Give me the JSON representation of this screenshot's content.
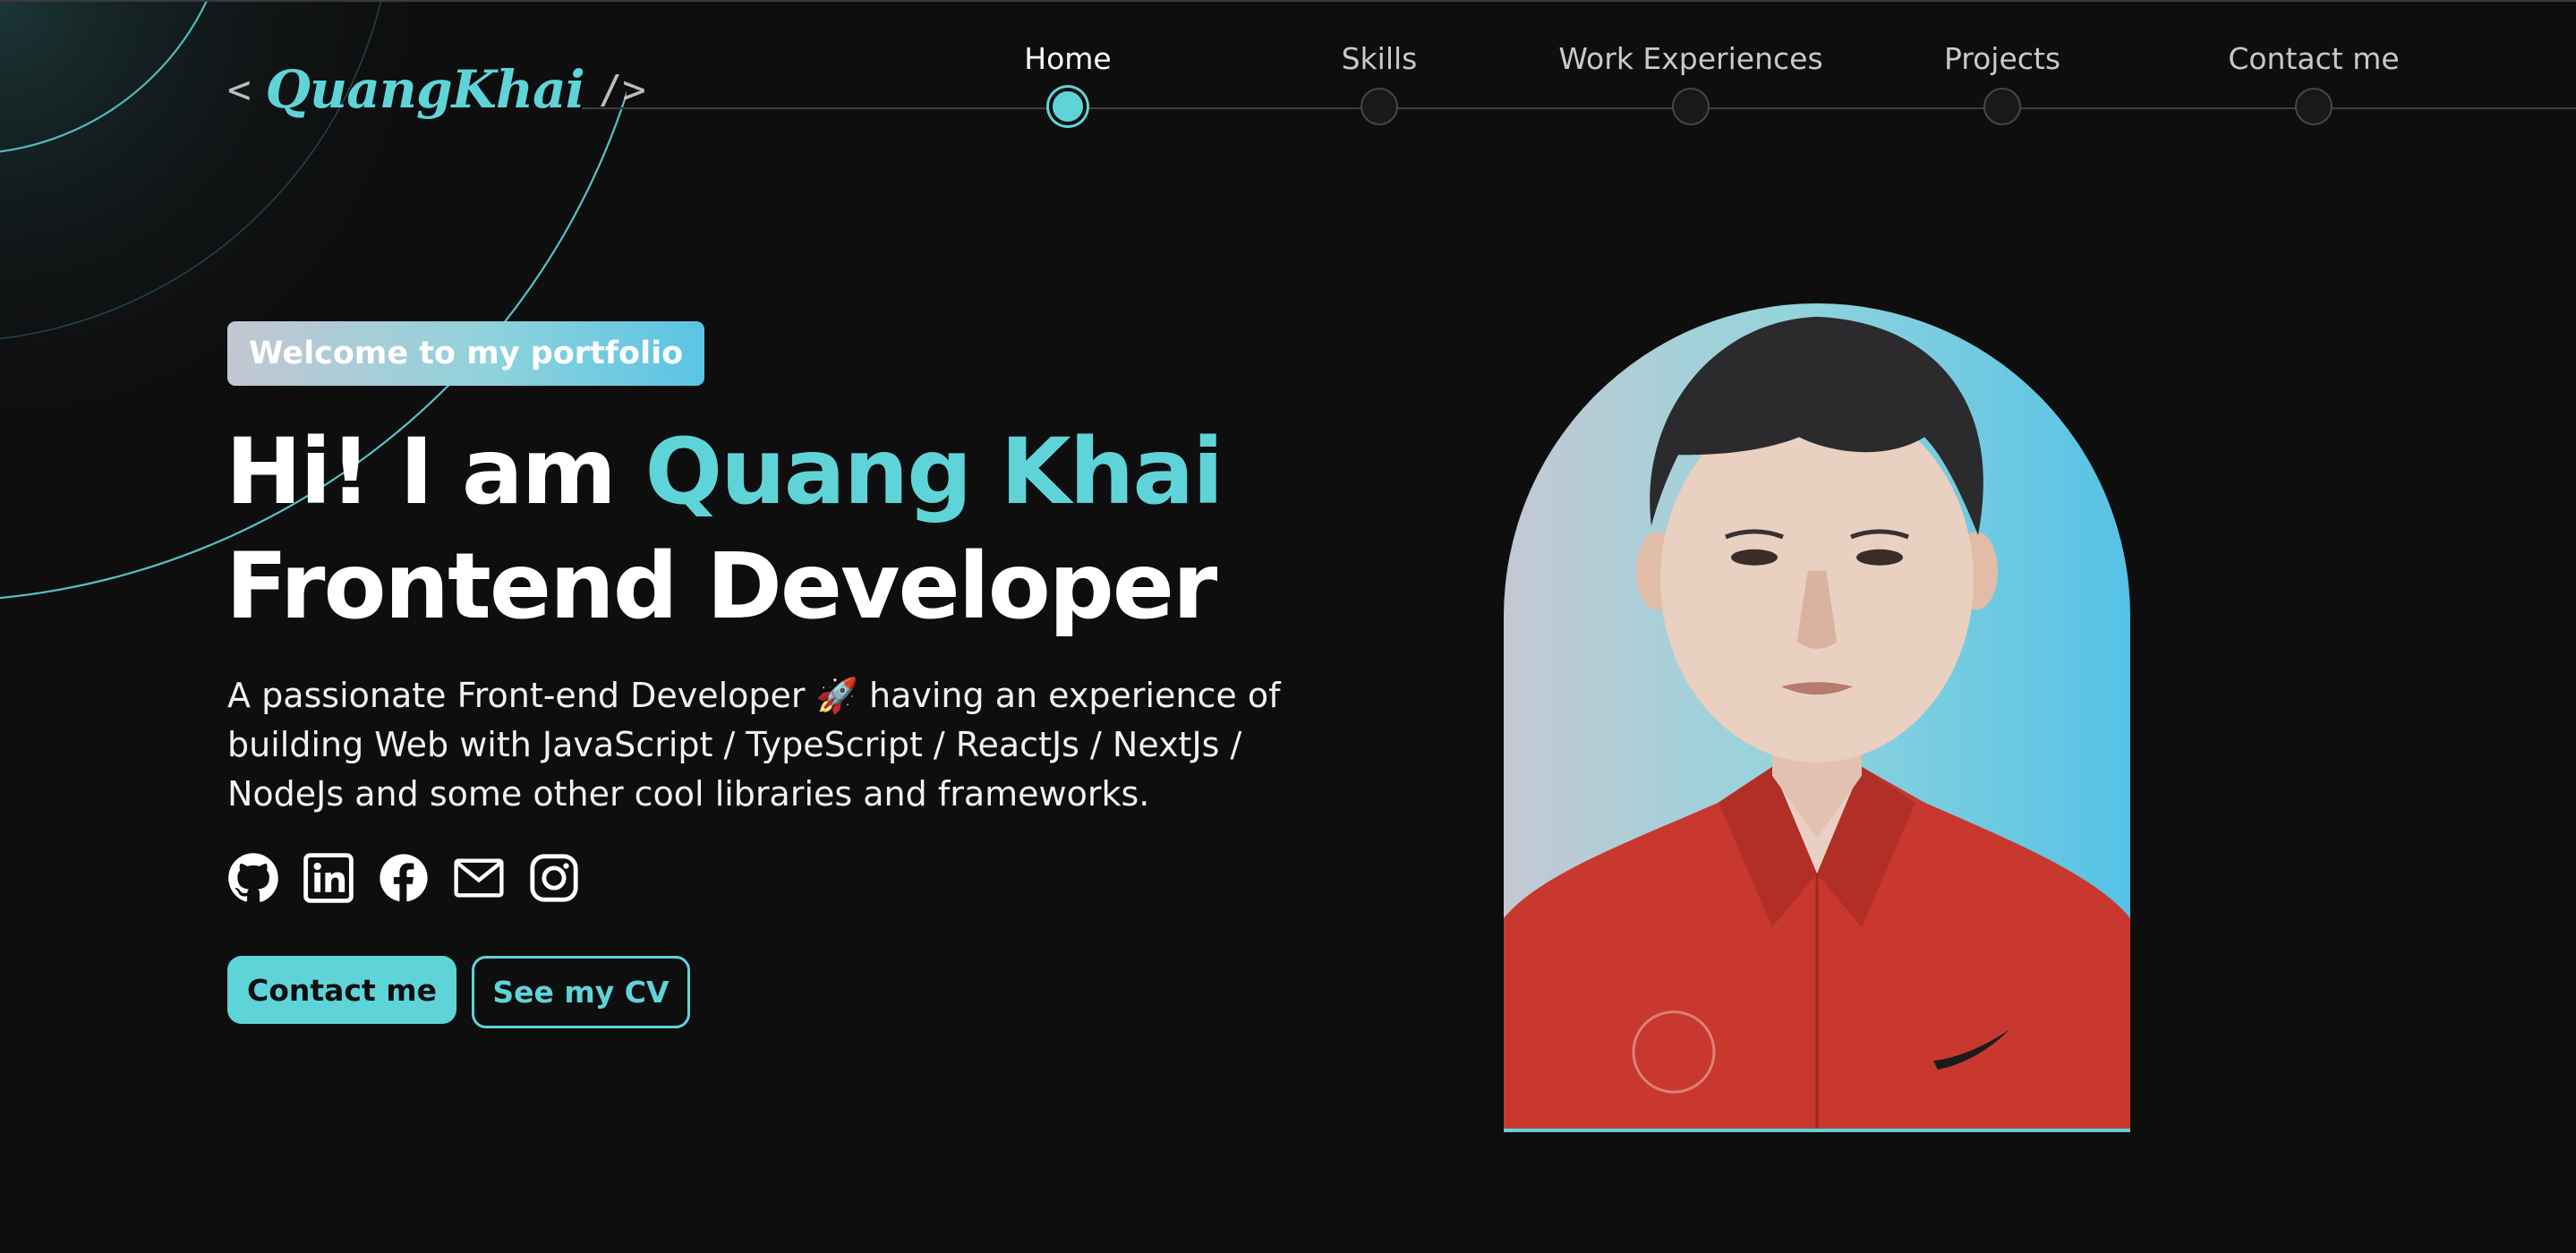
{
  "logo": {
    "open_bracket": "<",
    "name": "QuangKhai",
    "close_bracket": "/>"
  },
  "nav": {
    "items": [
      {
        "label": "Home",
        "active": true
      },
      {
        "label": "Skills",
        "active": false
      },
      {
        "label": "Work Experiences",
        "active": false
      },
      {
        "label": "Projects",
        "active": false
      },
      {
        "label": "Contact me",
        "active": false
      }
    ]
  },
  "hero": {
    "badge": "Welcome to my portfolio",
    "greeting": "Hi! I am",
    "name": "Quang Khai",
    "role": "Frontend Developer",
    "intro": "A passionate Front-end Developer 🚀 having an experience of building Web with JavaScript / TypeScript / ReactJs / NextJs / NodeJs and some other cool libraries and frameworks."
  },
  "socials": [
    {
      "icon": "github-icon"
    },
    {
      "icon": "linkedin-icon"
    },
    {
      "icon": "facebook-icon"
    },
    {
      "icon": "mail-icon"
    },
    {
      "icon": "instagram-icon"
    }
  ],
  "buttons": {
    "contact": "Contact me",
    "cv": "See my CV"
  },
  "colors": {
    "accent": "#5fd4d8",
    "background": "#0e0e0f",
    "text": "#ffffff"
  }
}
